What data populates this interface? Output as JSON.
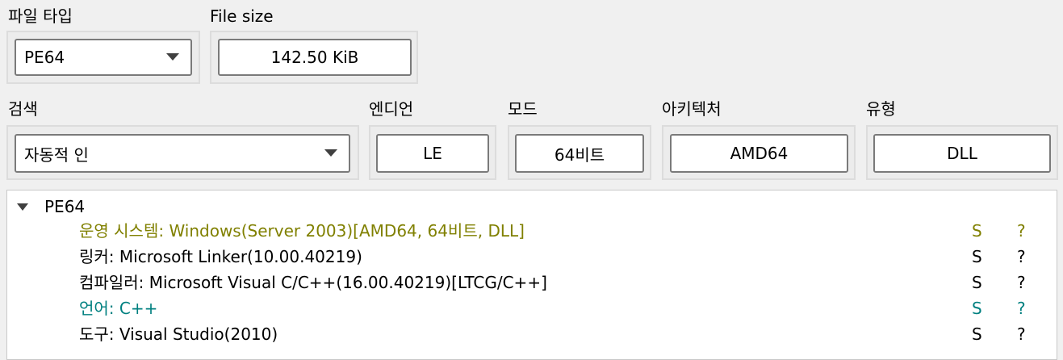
{
  "file_type": {
    "label": "파일 타입",
    "value": "PE64"
  },
  "file_size": {
    "label": "File size",
    "value": "142.50 KiB"
  },
  "scan": {
    "label": "검색",
    "value": "자동적 인"
  },
  "endian": {
    "label": "엔디언",
    "value": "LE"
  },
  "mode": {
    "label": "모드",
    "value": "64비트"
  },
  "arch": {
    "label": "아키텍처",
    "value": "AMD64"
  },
  "type": {
    "label": "유형",
    "value": "DLL"
  },
  "tree": {
    "root_label": "PE64",
    "rows": [
      {
        "text": "운영 시스템: Windows(Server 2003)[AMD64, 64비트, DLL]",
        "col_s": "S",
        "col_q": "?",
        "color": "#808000"
      },
      {
        "text": "링커: Microsoft Linker(10.00.40219)",
        "col_s": "S",
        "col_q": "?",
        "color": "#000000"
      },
      {
        "text": "컴파일러: Microsoft Visual C/C++(16.00.40219)[LTCG/C++]",
        "col_s": "S",
        "col_q": "?",
        "color": "#000000"
      },
      {
        "text": "언어: C++",
        "col_s": "S",
        "col_q": "?",
        "color": "#008080"
      },
      {
        "text": "도구: Visual Studio(2010)",
        "col_s": "S",
        "col_q": "?",
        "color": "#000000"
      }
    ]
  }
}
